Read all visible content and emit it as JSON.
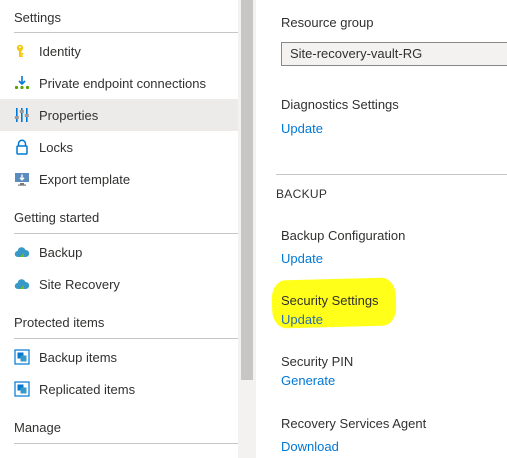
{
  "sections": {
    "settings": "Settings",
    "getting_started": "Getting started",
    "protected_items": "Protected items",
    "manage": "Manage"
  },
  "nav_items": {
    "identity": "Identity",
    "private_endpoint": "Private endpoint connections",
    "properties": "Properties",
    "locks": "Locks",
    "export_template": "Export template",
    "backup": "Backup",
    "site_recovery": "Site Recovery",
    "backup_items": "Backup items",
    "replicated_items": "Replicated items"
  },
  "selected_item": "Properties",
  "content": {
    "resource_group_label": "Resource group",
    "resource_group_value": "Site-recovery-vault-RG",
    "diagnostics_label": "Diagnostics Settings",
    "diagnostics_link": "Update",
    "backup_section": "BACKUP",
    "backup_config_label": "Backup Configuration",
    "backup_config_link": "Update",
    "security_settings_label": "Security Settings",
    "security_settings_link": "Update",
    "security_pin_label": "Security PIN",
    "security_pin_link": "Generate",
    "recovery_agent_label": "Recovery Services Agent",
    "recovery_agent_link": "Download"
  },
  "colors": {
    "link": "#0078d4",
    "selected_bg": "#edebe9",
    "highlight": "#ffff1a"
  },
  "icons": {
    "identity": "key-icon",
    "private_endpoint": "endpoint-icon",
    "properties": "sliders-icon",
    "locks": "lock-icon",
    "export_template": "monitor-download-icon",
    "backup": "cloud-icon",
    "site_recovery": "cloud-icon",
    "backup_items": "backup-items-icon",
    "replicated_items": "replicated-items-icon"
  }
}
